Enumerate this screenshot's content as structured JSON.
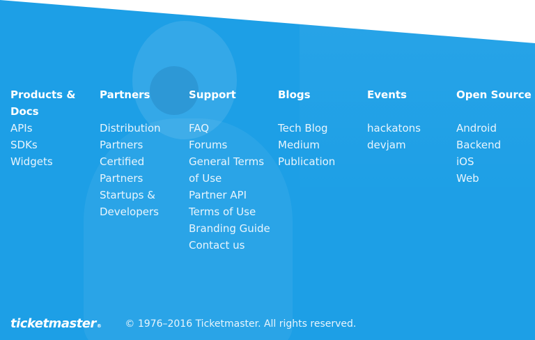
{
  "colors": {
    "footer_background": "#1d9fe6",
    "text": "#ffffff"
  },
  "columns": [
    {
      "title": "Products & Docs",
      "items": [
        "APIs",
        "SDKs",
        "Widgets"
      ]
    },
    {
      "title": "Partners",
      "items": [
        "Distribution Partners",
        "Certified Partners",
        "Startups & Developers"
      ]
    },
    {
      "title": "Support",
      "items": [
        "FAQ",
        "Forums",
        "General Terms of Use",
        "Partner API Terms of Use",
        "Branding Guide",
        "Contact us"
      ]
    },
    {
      "title": "Blogs",
      "items": [
        "Tech Blog",
        "Medium Publication"
      ]
    },
    {
      "title": "Events",
      "items": [
        "hackatons",
        "devjam"
      ]
    },
    {
      "title": "Open Source",
      "items": [
        "Android",
        "Backend",
        "iOS",
        "Web"
      ]
    }
  ],
  "footer": {
    "logo_text": "ticketmaster",
    "logo_mark": "®",
    "copyright": "© 1976–2016 Ticketmaster. All rights reserved."
  }
}
